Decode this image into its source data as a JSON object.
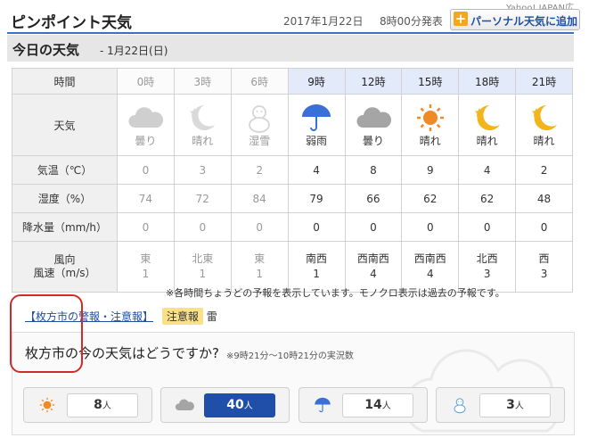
{
  "header": {
    "title": "ピンポイント天気",
    "date": "2017年1月22日",
    "published": "8時00分発表",
    "personal_button": "パーソナル天気に追加",
    "top_right": "Yahoo! JAPAN広告"
  },
  "today": {
    "title": "今日の天気",
    "date": "- 1月22日(日)"
  },
  "table": {
    "labels": {
      "time": "時間",
      "weather": "天気",
      "temp": "気温（℃）",
      "humidity": "湿度（%）",
      "precip": "降水量（mm/h）",
      "wind_dir": "風向",
      "wind_speed": "風速（m/s）"
    },
    "columns": [
      {
        "time": "0時",
        "weather": "曇り",
        "icon": "cloud-icon",
        "temp": "0",
        "humidity": "74",
        "precip": "0",
        "wind_dir": "東",
        "wind_speed": "1",
        "past": true
      },
      {
        "time": "3時",
        "weather": "晴れ",
        "icon": "moon-icon",
        "temp": "3",
        "humidity": "72",
        "precip": "0",
        "wind_dir": "北東",
        "wind_speed": "1",
        "past": true
      },
      {
        "time": "6時",
        "weather": "湿雪",
        "icon": "snowman-icon",
        "temp": "2",
        "humidity": "84",
        "precip": "0",
        "wind_dir": "東",
        "wind_speed": "1",
        "past": true
      },
      {
        "time": "9時",
        "weather": "弱雨",
        "icon": "umbrella-icon",
        "temp": "4",
        "humidity": "79",
        "precip": "0",
        "wind_dir": "南西",
        "wind_speed": "1",
        "past": false
      },
      {
        "time": "12時",
        "weather": "曇り",
        "icon": "cloud-icon",
        "temp": "8",
        "humidity": "66",
        "precip": "0",
        "wind_dir": "西南西",
        "wind_speed": "4",
        "past": false
      },
      {
        "time": "15時",
        "weather": "晴れ",
        "icon": "sun-icon",
        "temp": "9",
        "humidity": "62",
        "precip": "0",
        "wind_dir": "西南西",
        "wind_speed": "4",
        "past": false
      },
      {
        "time": "18時",
        "weather": "晴れ",
        "icon": "moon-icon",
        "temp": "4",
        "humidity": "62",
        "precip": "0",
        "wind_dir": "北西",
        "wind_speed": "3",
        "past": false
      },
      {
        "time": "21時",
        "weather": "晴れ",
        "icon": "moon-icon",
        "temp": "2",
        "humidity": "48",
        "precip": "0",
        "wind_dir": "西",
        "wind_speed": "3",
        "past": false
      }
    ]
  },
  "note": "※各時間ちょうどの予報を表示しています。モノクロ表示は過去の予報です。",
  "alert": {
    "link": "【枚方市の警報・注意報】",
    "badge": "注意報",
    "text": "雷"
  },
  "survey": {
    "question": "枚方市の今の天気はどうですか?",
    "sub": "※9時21分～10時21分の実況数",
    "unit": "人",
    "options": [
      {
        "icon": "sun-icon",
        "count": "8",
        "selected": false
      },
      {
        "icon": "cloud-icon",
        "count": "40",
        "selected": true
      },
      {
        "icon": "umbrella-icon",
        "count": "14",
        "selected": false
      },
      {
        "icon": "snowman-icon",
        "count": "3",
        "selected": false
      }
    ]
  },
  "colors": {
    "accent": "#1f4fa8",
    "sun": "#f08a24",
    "moon": "#f2b51c",
    "alert_badge": "#fbe08a",
    "highlight_box": "#d02a2a"
  }
}
